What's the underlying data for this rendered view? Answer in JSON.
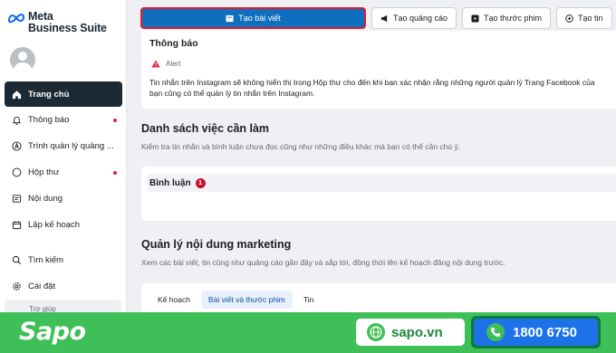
{
  "app": {
    "logo_line1": "Meta",
    "logo_line2": "Business Suite"
  },
  "sidebar": {
    "items": [
      {
        "label": "Trang chủ",
        "icon": "home-icon",
        "active": true
      },
      {
        "label": "Thông báo",
        "icon": "bell-icon",
        "dot": true
      },
      {
        "label": "Trình quản lý quảng ...",
        "icon": "ads-manager-icon"
      },
      {
        "label": "Hộp thư",
        "icon": "chat-bubble-icon",
        "dot": true
      },
      {
        "label": "Nội dung",
        "icon": "content-icon"
      },
      {
        "label": "Lập kế hoạch",
        "icon": "calendar-icon"
      },
      {
        "label": "Tìm kiếm",
        "icon": "search-icon"
      },
      {
        "label": "Cài đặt",
        "icon": "gear-icon"
      }
    ],
    "partial_item": "Trợ giúp"
  },
  "toolbar": {
    "create_post": "Tạo bài viết",
    "create_ad": "Tạo quảng cáo",
    "create_reel": "Tạo thước phim",
    "create_story": "Tạo tin"
  },
  "notification": {
    "title": "Thông báo",
    "alert_label": "Alert",
    "body": "Tin nhắn trên Instagram sẽ không hiển thị trong Hộp thư cho đến khi bạn xác nhận rằng những người quản lý Trang Facebook của bạn cũng có thể quản lý tin nhắn trên Instagram."
  },
  "todo": {
    "title": "Danh sách việc cần làm",
    "subtitle": "Kiểm tra tin nhắn và bình luận chưa đọc cũng như những điều khác mà bạn có thể cần chú ý.",
    "comments_label": "Bình luận",
    "comments_count": "1"
  },
  "marketing": {
    "title": "Quản lý nội dung marketing",
    "subtitle": "Xem các bài viết, tin cũng như quảng cáo gần đây và sắp tới, đồng thời lên kế hoạch đăng nội dung trước.",
    "tabs": [
      "Kế hoạch",
      "Bài viết và thước phim",
      "Tin"
    ],
    "active_tab": 1
  },
  "footer": {
    "brand": "Sapo",
    "website": "sapo.vn",
    "phone": "1800 6750"
  },
  "colors": {
    "primary_button": "#0f6ebd",
    "highlight_border": "#e21b2a",
    "sidebar_active": "#1c2b33",
    "footer_green": "#3fbf57",
    "phone_blue": "#1d72e8"
  }
}
